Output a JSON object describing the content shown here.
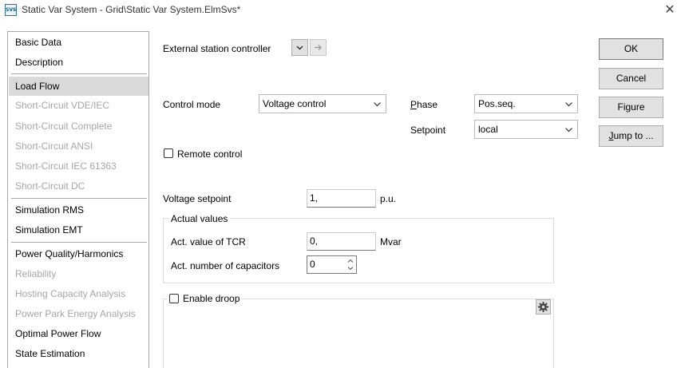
{
  "window": {
    "title": "Static Var System - Grid\\Static Var System.ElmSvs*",
    "app_icon_text": "SVS",
    "close_glyph": "✕"
  },
  "sidebar": {
    "items": [
      {
        "label": "Basic Data",
        "state": "normal"
      },
      {
        "label": "Description",
        "state": "normal"
      },
      {
        "label": "Load Flow",
        "state": "selected"
      },
      {
        "label": "Short-Circuit VDE/IEC",
        "state": "disabled"
      },
      {
        "label": "Short-Circuit Complete",
        "state": "disabled"
      },
      {
        "label": "Short-Circuit ANSI",
        "state": "disabled"
      },
      {
        "label": "Short-Circuit IEC 61363",
        "state": "disabled"
      },
      {
        "label": "Short-Circuit DC",
        "state": "disabled"
      },
      {
        "label": "Simulation RMS",
        "state": "normal"
      },
      {
        "label": "Simulation EMT",
        "state": "normal"
      },
      {
        "label": "Power Quality/Harmonics",
        "state": "normal"
      },
      {
        "label": "Reliability",
        "state": "disabled"
      },
      {
        "label": "Hosting Capacity Analysis",
        "state": "disabled"
      },
      {
        "label": "Power Park Energy Analysis",
        "state": "disabled"
      },
      {
        "label": "Optimal Power Flow",
        "state": "normal"
      },
      {
        "label": "State Estimation",
        "state": "normal"
      }
    ]
  },
  "form": {
    "external_station_controller_label": "External station controller",
    "control_mode_label": "Control mode",
    "control_mode_value": "Voltage control",
    "phase_label_first": "P",
    "phase_label_rest": "hase",
    "phase_value": "Pos.seq.",
    "setpoint_label": "Setpoint",
    "setpoint_value": "local",
    "remote_control_label": "Remote control",
    "remote_control_checked": false,
    "voltage_setpoint_label": "Voltage setpoint",
    "voltage_setpoint_value": "1,",
    "voltage_setpoint_unit": "p.u.",
    "actual_values_title": "Actual values",
    "tcr_label": "Act. value of TCR",
    "tcr_value": "0,",
    "tcr_unit": "Mvar",
    "capacitors_label": "Act. number of capacitors",
    "capacitors_value": "0",
    "enable_droop_label": "Enable droop",
    "enable_droop_checked": false
  },
  "buttons": {
    "ok": "OK",
    "cancel": "Cancel",
    "figure": "Figure",
    "jump_first": "J",
    "jump_rest": "ump to ..."
  },
  "icons": {
    "dropdown": "chevron-down-icon",
    "jump_arrow": "arrow-right-icon",
    "settings": "gear-icon"
  },
  "colors": {
    "selected_item_bg": "#d9d9d9",
    "disabled_text": "#a6a6a6",
    "button_bg": "#e1e1e1"
  }
}
